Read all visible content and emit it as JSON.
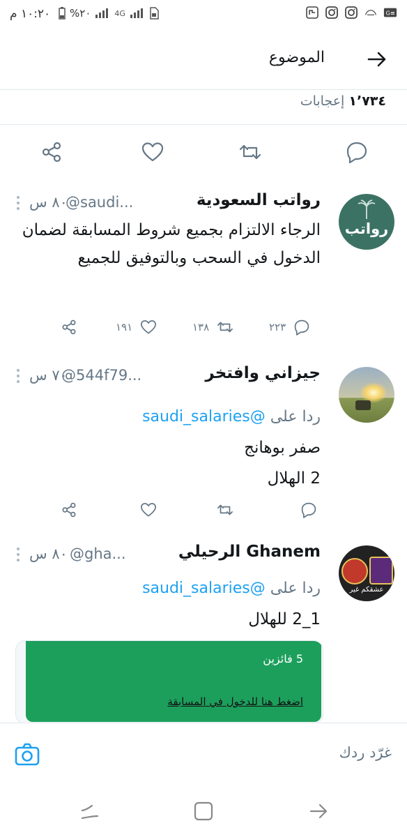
{
  "status_bar": {
    "time": "١٠:٢٠ م",
    "battery": "%٢٠",
    "network": "4G"
  },
  "header": {
    "title": "الموضوع"
  },
  "main_tweet": {
    "likes_count": "١٬٧٣٤",
    "likes_label": "إعجابات"
  },
  "tweets": [
    {
      "name": "رواتب السعودية",
      "handle": "@saudi...",
      "time": "٨٠ س",
      "text": "الرجاء الالتزام بجميع شروط المسابقة لضمان الدخول في السحب وبالتوفيق للجميع",
      "replies": "٢٢٣",
      "retweets": "١٣٨",
      "likes": "١٩١",
      "avatar_text": "رواتب"
    },
    {
      "name": "جيزاني وافتخر",
      "handle": "@544f79...",
      "time": "٧٠ س",
      "reply_to_label": "ردا على",
      "reply_to_handle": "@saudi_salaries",
      "line1": "صفر بوهانج",
      "line2": "2 الهلال"
    },
    {
      "name": "الرحيلي Ghanem",
      "handle": "@gha...",
      "time": "٨٠ س",
      "reply_to_label": "ردا على",
      "reply_to_handle": "@saudi_salaries",
      "line1": "1_2 للهلال",
      "card_winners": "5 فائزين",
      "card_link": "اضغط هنا للدخول في المسابقة",
      "avatar_text": "عشقكم غير"
    }
  ],
  "reply_bar": {
    "placeholder": "غرّد ردك"
  },
  "colors": {
    "accent": "#1da1f2",
    "secondary_text": "#657786",
    "divider": "#e1e8ed",
    "card_green": "#1d9f5c"
  },
  "icons": [
    "back-arrow-icon",
    "share-icon",
    "like-icon",
    "retweet-icon",
    "reply-icon",
    "more-vert-icon",
    "camera-icon",
    "recent-apps-icon",
    "home-icon",
    "back-nav-icon"
  ]
}
